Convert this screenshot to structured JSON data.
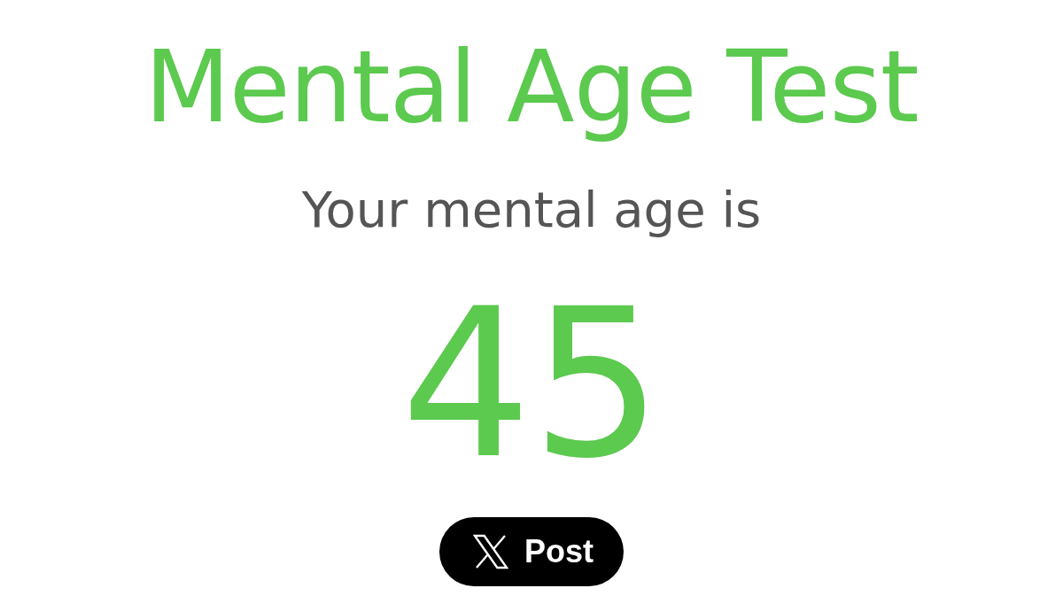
{
  "title": "Mental Age Test",
  "subtitle": "Your mental age is",
  "result": "45",
  "share_button": {
    "label": "Post"
  }
}
